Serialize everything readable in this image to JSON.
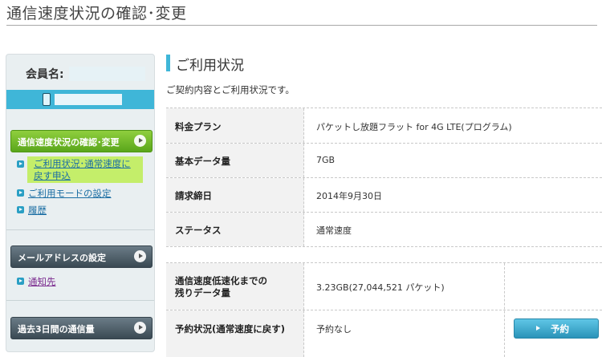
{
  "page": {
    "title": "通信速度状況の確認･変更"
  },
  "sidebar": {
    "member_label": "会員名:",
    "menus": [
      {
        "label": "通信速度状況の確認･変更"
      },
      {
        "label": "メールアドレスの設定"
      },
      {
        "label": "過去3日間の通信量"
      }
    ],
    "sub_items": {
      "active": "ご利用状況･通常速度に\n戻す申込",
      "mode": "ご利用モードの設定",
      "history": "履歴",
      "notify": "通知先"
    }
  },
  "main": {
    "section_title": "ご利用状況",
    "intro": "ご契約内容とご利用状況です。",
    "rows": [
      {
        "label": "料金プラン",
        "value": "パケットし放題フラット for 4G LTE(プログラム)"
      },
      {
        "label": "基本データ量",
        "value": "7GB"
      },
      {
        "label": "請求締日",
        "value": "2014年9月30日"
      },
      {
        "label": "ステータス",
        "value": "通常速度"
      },
      {
        "label": "通信速度低速化までの\n残りデータ量",
        "value": "3.23GB(27,044,521 パケット)"
      },
      {
        "label": "予約状況(通常速度に戻す)",
        "value": "予約なし"
      }
    ],
    "reserve_button": "予約"
  },
  "colors": {
    "accent": "#3fb6d8",
    "green_button": "#5aa61b",
    "dark_button": "#3a4953",
    "highlight": "#c4ee6a"
  }
}
